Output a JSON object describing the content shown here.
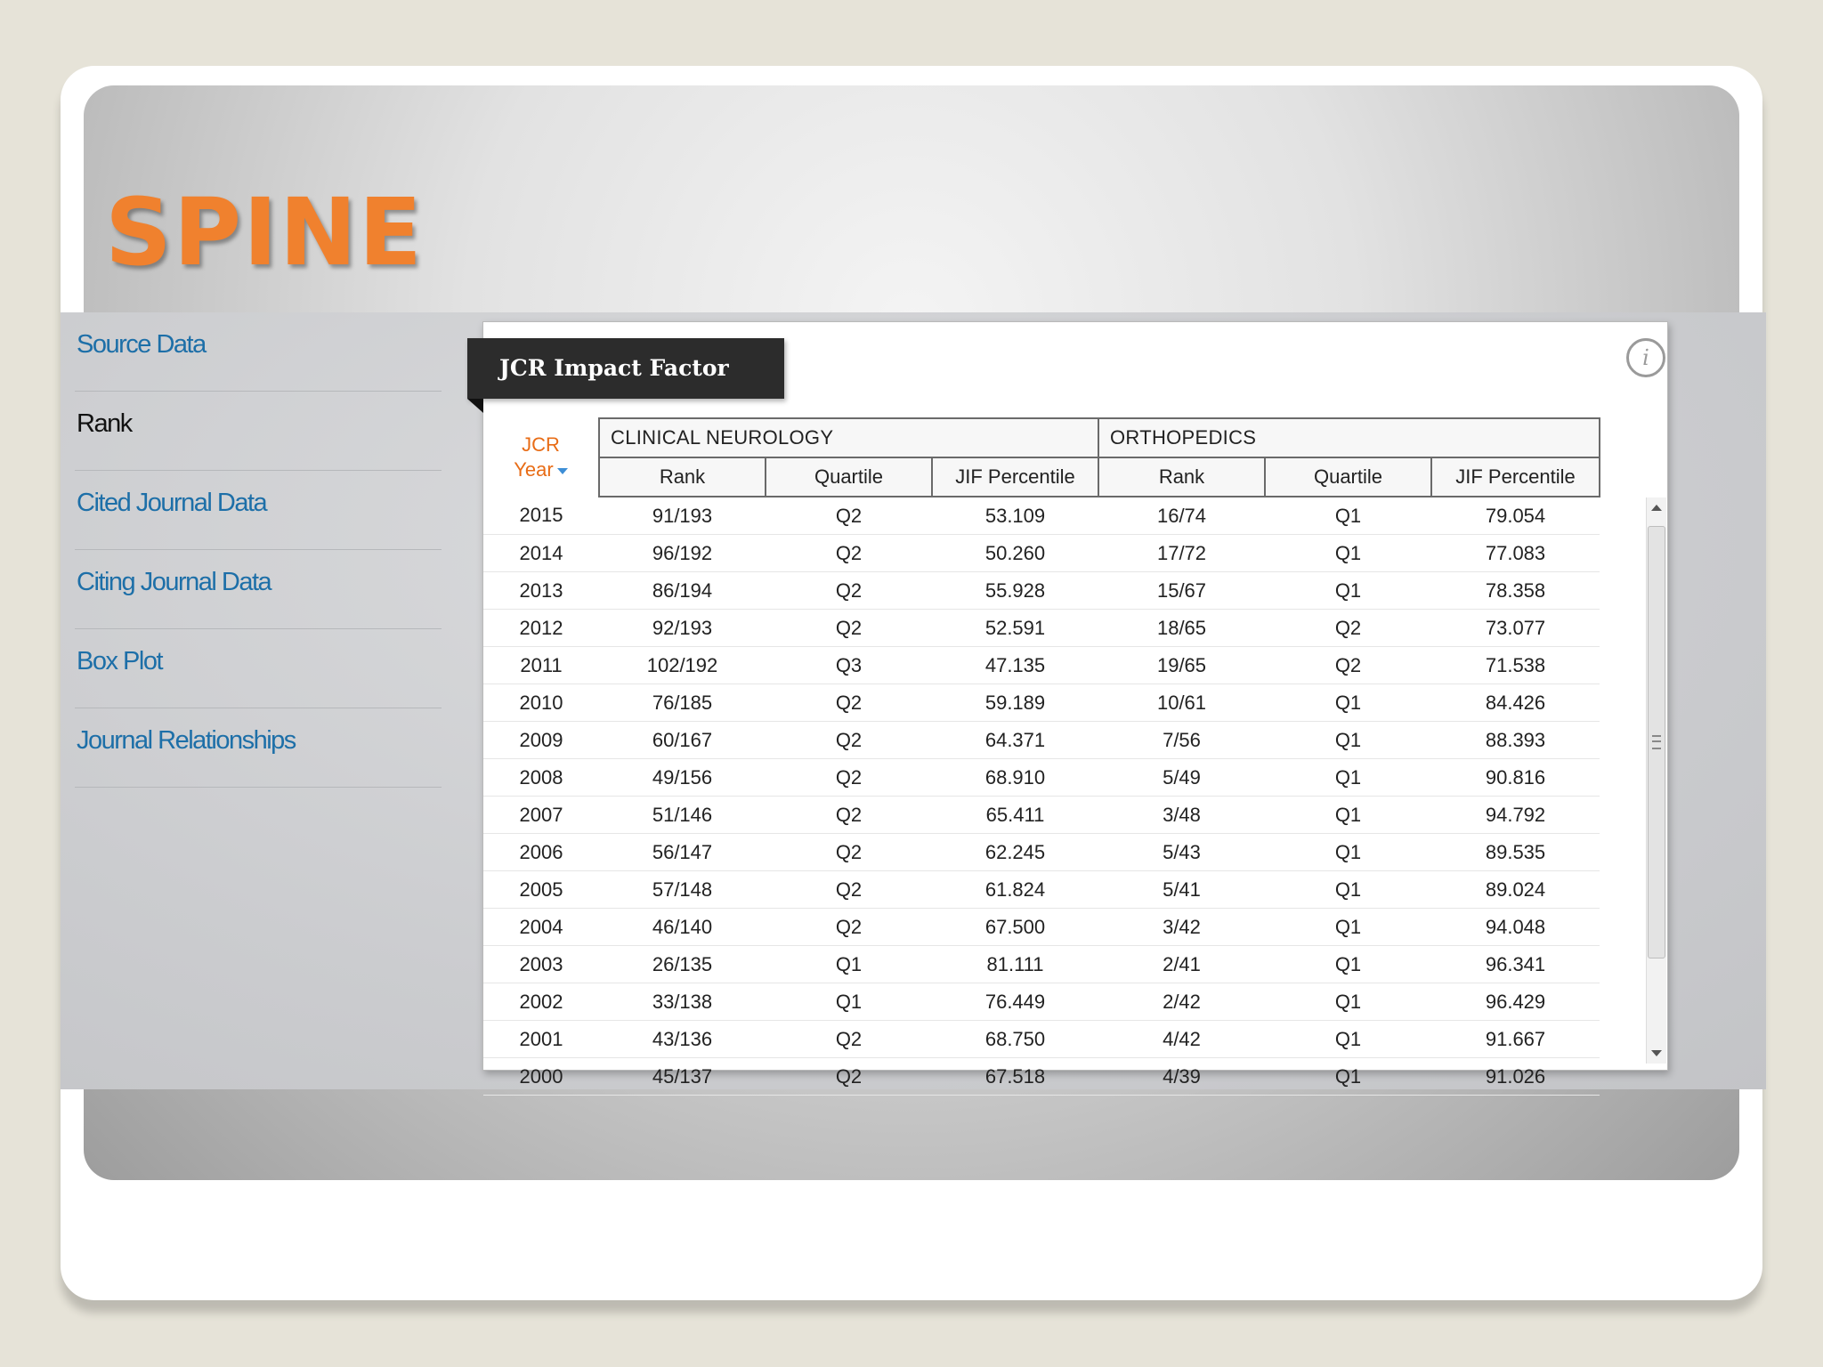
{
  "slide_title": "SPINE",
  "sidebar": {
    "items": [
      {
        "label": "Source Data"
      },
      {
        "label": "Rank"
      },
      {
        "label": "Cited Journal Data"
      },
      {
        "label": "Citing Journal Data"
      },
      {
        "label": "Box Plot"
      },
      {
        "label": "Journal Relationships"
      }
    ],
    "active": "Rank"
  },
  "panel": {
    "tab_label": "JCR Impact Factor",
    "info_icon": "i"
  },
  "table": {
    "year_header_line1": "JCR",
    "year_header_line2": "Year",
    "groups": [
      "CLINICAL NEUROLOGY",
      "ORTHOPEDICS"
    ],
    "sub_headers": [
      "Rank",
      "Quartile",
      "JIF Percentile",
      "Rank",
      "Quartile",
      "JIF Percentile"
    ],
    "rows": [
      [
        "2015",
        "91/193",
        "Q2",
        "53.109",
        "16/74",
        "Q1",
        "79.054"
      ],
      [
        "2014",
        "96/192",
        "Q2",
        "50.260",
        "17/72",
        "Q1",
        "77.083"
      ],
      [
        "2013",
        "86/194",
        "Q2",
        "55.928",
        "15/67",
        "Q1",
        "78.358"
      ],
      [
        "2012",
        "92/193",
        "Q2",
        "52.591",
        "18/65",
        "Q2",
        "73.077"
      ],
      [
        "2011",
        "102/192",
        "Q3",
        "47.135",
        "19/65",
        "Q2",
        "71.538"
      ],
      [
        "2010",
        "76/185",
        "Q2",
        "59.189",
        "10/61",
        "Q1",
        "84.426"
      ],
      [
        "2009",
        "60/167",
        "Q2",
        "64.371",
        "7/56",
        "Q1",
        "88.393"
      ],
      [
        "2008",
        "49/156",
        "Q2",
        "68.910",
        "5/49",
        "Q1",
        "90.816"
      ],
      [
        "2007",
        "51/146",
        "Q2",
        "65.411",
        "3/48",
        "Q1",
        "94.792"
      ],
      [
        "2006",
        "56/147",
        "Q2",
        "62.245",
        "5/43",
        "Q1",
        "89.535"
      ],
      [
        "2005",
        "57/148",
        "Q2",
        "61.824",
        "5/41",
        "Q1",
        "89.024"
      ],
      [
        "2004",
        "46/140",
        "Q2",
        "67.500",
        "3/42",
        "Q1",
        "94.048"
      ],
      [
        "2003",
        "26/135",
        "Q1",
        "81.111",
        "2/41",
        "Q1",
        "96.341"
      ],
      [
        "2002",
        "33/138",
        "Q1",
        "76.449",
        "2/42",
        "Q1",
        "96.429"
      ],
      [
        "2001",
        "43/136",
        "Q2",
        "68.750",
        "4/42",
        "Q1",
        "91.667"
      ],
      [
        "2000",
        "45/137",
        "Q2",
        "67.518",
        "4/39",
        "Q1",
        "91.026"
      ]
    ]
  },
  "colors": {
    "title": "#f0812e",
    "link": "#1d6fa8",
    "year_header": "#e86c16",
    "tab_background": "#2c2c2c"
  }
}
